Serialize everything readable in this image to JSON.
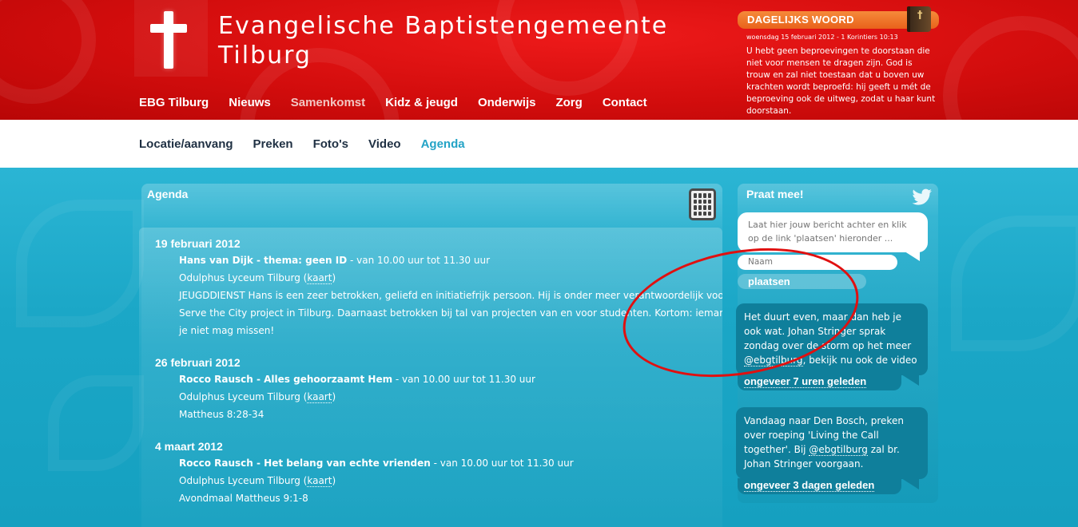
{
  "header": {
    "site_title_line1": "Evangelische Baptistengemeente",
    "site_title_line2": "Tilburg",
    "nav": [
      {
        "label": "EBG Tilburg"
      },
      {
        "label": "Nieuws"
      },
      {
        "label": "Samenkomst",
        "active": true
      },
      {
        "label": "Kidz & jeugd"
      },
      {
        "label": "Onderwijs"
      },
      {
        "label": "Zorg"
      },
      {
        "label": "Contact"
      }
    ],
    "accent_color": "#d30d0d"
  },
  "daily_word": {
    "heading": "DAGELIJKS WOORD",
    "date_ref": "woensdag 15 februari 2012 - 1 Korintiers 10:13",
    "text": "U hebt geen beproevingen te doorstaan die niet voor mensen te dragen zijn. God is trouw en zal niet toestaan dat u boven uw krachten wordt beproefd: hij geeft u mét de beproeving ook de uitweg, zodat u haar kunt doorstaan.",
    "header_color": "#ef7a2e",
    "book_icon": "bible-icon"
  },
  "subnav": {
    "items": [
      {
        "label": "Locatie/aanvang"
      },
      {
        "label": "Preken"
      },
      {
        "label": "Foto's"
      },
      {
        "label": "Video"
      },
      {
        "label": "Agenda",
        "active": true
      }
    ],
    "active_color": "#23a3c6"
  },
  "agenda": {
    "title": "Agenda",
    "calendar_icon": "calendar-icon",
    "events": [
      {
        "date": "19 februari 2012",
        "speaker_title": "Hans van Dijk - thema: geen ID",
        "time": " - van 10.00 uur tot 11.30 uur",
        "location": "Odulphus Lyceum Tilburg (",
        "map_link": "kaart",
        "location_end": ")",
        "desc1": "JEUGDDIENST Hans is een zeer betrokken, geliefd en initiatiefrijk persoon. Hij is onder meer verantwoordelijk voor het",
        "desc2": "Serve the City project in Tilburg. Daarnaast betrokken bij tal van projecten van en voor studenten. Kortom: iemand die",
        "desc3": "je niet mag missen!"
      },
      {
        "date": "26 februari 2012",
        "speaker_title": "Rocco Rausch - Alles gehoorzaamt Hem",
        "time": " - van 10.00 uur tot 11.30 uur",
        "location": "Odulphus Lyceum Tilburg (",
        "map_link": "kaart",
        "location_end": ")",
        "desc1": "Mattheus 8:28-34"
      },
      {
        "date": "4 maart 2012",
        "speaker_title": "Rocco Rausch - Het belang van echte vrienden",
        "time": " - van 10.00 uur tot 11.30 uur",
        "location": "Odulphus Lyceum Tilburg (",
        "map_link": "kaart",
        "location_end": ")",
        "desc1": "Avondmaal Mattheus 9:1-8"
      }
    ]
  },
  "twitter": {
    "title": "Praat mee!",
    "bird_icon": "twitter-bird-icon",
    "message_placeholder": "Laat hier jouw bericht achter en klik op de link 'plaatsen' hieronder ...",
    "name_placeholder": "Naam",
    "post_label": "plaatsen",
    "tweets": [
      {
        "text_before": "Het duurt even, maar dan heb je ook wat. Johan Stringer sprak zondag over de storm op het meer ",
        "mention": "@ebgtilburg",
        "text_after": ", bekijk nu ook de video",
        "time": "ongeveer 7 uren geleden"
      },
      {
        "text_before": "Vandaag naar Den Bosch, preken over roeping 'Living the Call together'. Bij ",
        "mention": "@ebgtilburg",
        "text_after": " zal br. Johan Stringer voorgaan.",
        "time": "ongeveer 3 dagen geleden"
      }
    ],
    "tweet_color": "#0f7f9b"
  },
  "annotation": {
    "shape": "red-ellipse-highlight",
    "color": "#e01010"
  }
}
